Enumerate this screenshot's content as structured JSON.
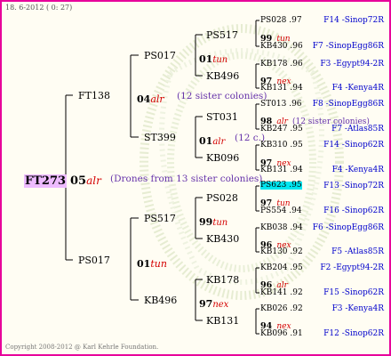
{
  "header": "18. 6-2012 ( 0: 27)",
  "footer": "Copyright 2008-2012 @ Karl Kehrle Foundation.",
  "root": {
    "name": "FT273",
    "gen": "05",
    "sym": "alr",
    "note": "(Drones from 13 sister colonies)"
  },
  "g1": [
    {
      "name": "FT138",
      "gen": "04",
      "sym": "alr",
      "note": "(12 sister colonies)"
    },
    {
      "name": "PS017",
      "gen": "01",
      "sym": "tun",
      "note": ""
    }
  ],
  "g2": [
    {
      "name": "PS017",
      "gen": "01",
      "sym": "tun",
      "note": ""
    },
    {
      "name": "ST399",
      "gen": "01",
      "sym": "alr",
      "note": "(12 c.)"
    },
    {
      "name": "PS517",
      "gen": "99",
      "sym": "tun",
      "note": ""
    },
    {
      "name": "KB496",
      "gen": "97",
      "sym": "nex",
      "note": ""
    }
  ],
  "g3": [
    {
      "name": "PS517",
      "gen": "99",
      "sym": "tun",
      "note": ""
    },
    {
      "name": "KB496",
      "gen": "97",
      "sym": "nex",
      "note": ""
    },
    {
      "name": "ST031",
      "gen": "98",
      "sym": "alr",
      "note": "(12 sister colonies)"
    },
    {
      "name": "KB096",
      "gen": "97",
      "sym": "nex",
      "note": ""
    },
    {
      "name": "PS028",
      "gen": "97",
      "sym": "tun",
      "note": ""
    },
    {
      "name": "KB430",
      "gen": "96",
      "sym": "nex",
      "note": ""
    },
    {
      "name": "KB178",
      "gen": "96",
      "sym": "alr",
      "note": ""
    },
    {
      "name": "KB131",
      "gen": "94",
      "sym": "nex",
      "note": ""
    }
  ],
  "g4": [
    {
      "name": "PS028 .97",
      "right": "F14 -Sinop72R"
    },
    {
      "name": "KB430 .96",
      "right": "F7 -SinopEgg86R"
    },
    {
      "name": "KB178 .96",
      "right": "F3 -Egypt94-2R"
    },
    {
      "name": "KB131 .94",
      "right": "F4 -Kenya4R"
    },
    {
      "name": "ST013 .96",
      "right": "F8 -SinopEgg86R"
    },
    {
      "name": "KB247 .95",
      "right": "F7 -Atlas85R"
    },
    {
      "name": "KB310 .95",
      "right": "F14 -Sinop62R"
    },
    {
      "name": "KB131 .94",
      "right": "F4 -Kenya4R"
    },
    {
      "name": "PS623 .95",
      "right": "F13 -Sinop72R"
    },
    {
      "name": "PS554 .94",
      "right": "F16 -Sinop62R"
    },
    {
      "name": "KB038 .94",
      "right": "F6 -SinopEgg86R"
    },
    {
      "name": "KB130 .92",
      "right": "F5 -Atlas85R"
    },
    {
      "name": "KB204 .95",
      "right": "F2 -Egypt94-2R"
    },
    {
      "name": "KB141 .92",
      "right": "F15 -Sinop62R"
    },
    {
      "name": "KB026 .92",
      "right": "F3 -Kenya4R"
    },
    {
      "name": "KB096 .91",
      "right": "F12 -Sinop62R"
    }
  ]
}
